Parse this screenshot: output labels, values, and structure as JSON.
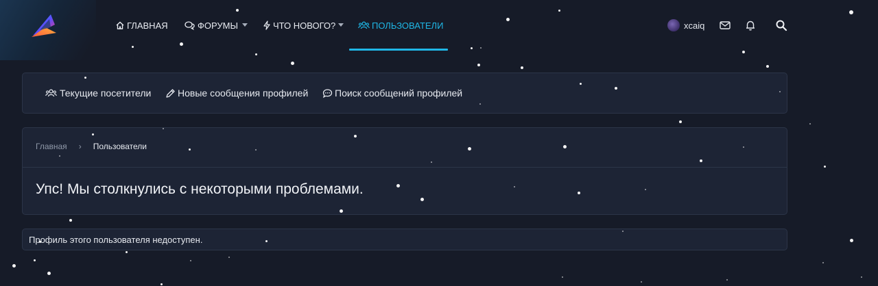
{
  "header": {
    "nav": [
      {
        "label": "ГЛАВНАЯ",
        "icon": "home-icon"
      },
      {
        "label": "ФОРУМЫ",
        "icon": "forums-icon"
      },
      {
        "label": "ЧТО НОВОГО?",
        "icon": "bolt-icon"
      },
      {
        "label": "ПОЛЬЗОВАТЕЛИ",
        "icon": "users-icon"
      }
    ],
    "active_nav": "ПОЛЬЗОВАТЕЛИ",
    "user": {
      "name": "xcaiq"
    },
    "accent_color": "#1fb7e6"
  },
  "subnav": {
    "items": [
      {
        "label": "Текущие посетители",
        "icon": "users-icon"
      },
      {
        "label": "Новые сообщения профилей",
        "icon": "pencil-icon"
      },
      {
        "label": "Поиск сообщений профилей",
        "icon": "comment-icon"
      }
    ]
  },
  "breadcrumb": {
    "items": [
      "Главная",
      "Пользователи"
    ]
  },
  "main": {
    "title": "Упс! Мы столкнулись с некоторыми проблемами.",
    "message": "Профиль этого пользователя недоступен."
  }
}
